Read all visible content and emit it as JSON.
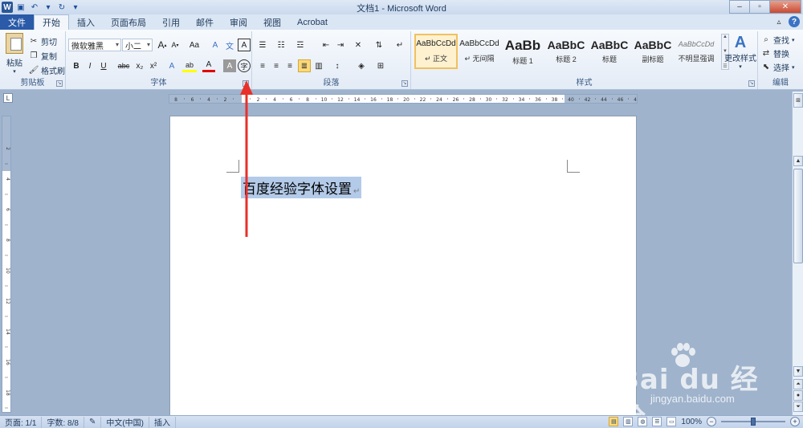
{
  "window": {
    "title": "文档1 - Microsoft Word"
  },
  "tabs": {
    "file": "文件",
    "items": [
      "开始",
      "插入",
      "页面布局",
      "引用",
      "邮件",
      "审阅",
      "视图",
      "Acrobat"
    ],
    "active": "开始"
  },
  "ribbon": {
    "clipboard": {
      "label": "剪贴板",
      "paste": "粘贴",
      "cut": "剪切",
      "copy": "复制",
      "format_painter": "格式刷"
    },
    "font": {
      "label": "字体",
      "font_name": "微软雅黑",
      "font_size": "小二",
      "grow": "A",
      "shrink": "A",
      "change_case": "Aa",
      "clear_format": "A",
      "phonetic": "文",
      "char_border": "A",
      "bold": "B",
      "italic": "I",
      "underline": "U",
      "strike": "abc",
      "subscript": "x₂",
      "superscript": "x²",
      "highlight": "ab",
      "font_color": "A",
      "char_shade": "A",
      "enclose": "字"
    },
    "paragraph": {
      "label": "段落"
    },
    "styles": {
      "label": "样式",
      "items": [
        {
          "sample": "AaBbCcDd",
          "name": "↵ 正文"
        },
        {
          "sample": "AaBbCcDd",
          "name": "↵ 无间隔"
        },
        {
          "sample": "AaBb",
          "name": "标题 1"
        },
        {
          "sample": "AaBbC",
          "name": "标题 2"
        },
        {
          "sample": "AaBbC",
          "name": "标题"
        },
        {
          "sample": "AaBbC",
          "name": "副标题"
        },
        {
          "sample": "AaBbCcDd",
          "name": "不明显强调"
        }
      ],
      "change_styles": "更改样式"
    },
    "editing": {
      "label": "编辑",
      "find": "查找",
      "replace": "替换",
      "select": "选择"
    }
  },
  "document": {
    "text": "百度经验字体设置",
    "para_mark": "↵"
  },
  "statusbar": {
    "page": "页面: 1/1",
    "words": "字数: 8/8",
    "language": "中文(中国)",
    "mode": "插入",
    "zoom": "100%",
    "zoom_level": 1.0
  },
  "watermark": {
    "brand": "Bai du 经验",
    "url": "jingyan.baidu.com"
  },
  "colors": {
    "file_tab": "#2a5aa8",
    "selection": "#b3cbe9",
    "annotation": "#e8302a"
  },
  "hruler_labels": [
    "8",
    "6",
    "4",
    "2",
    "",
    "2",
    "4",
    "6",
    "8",
    "10",
    "12",
    "14",
    "16",
    "18",
    "20",
    "22",
    "24",
    "26",
    "28",
    "30",
    "32",
    "34",
    "36",
    "38",
    "40",
    "42",
    "44",
    "46",
    "48"
  ],
  "vruler_labels": [
    "2",
    "4",
    "6",
    "8",
    "10",
    "12",
    "14",
    "16",
    "18"
  ]
}
